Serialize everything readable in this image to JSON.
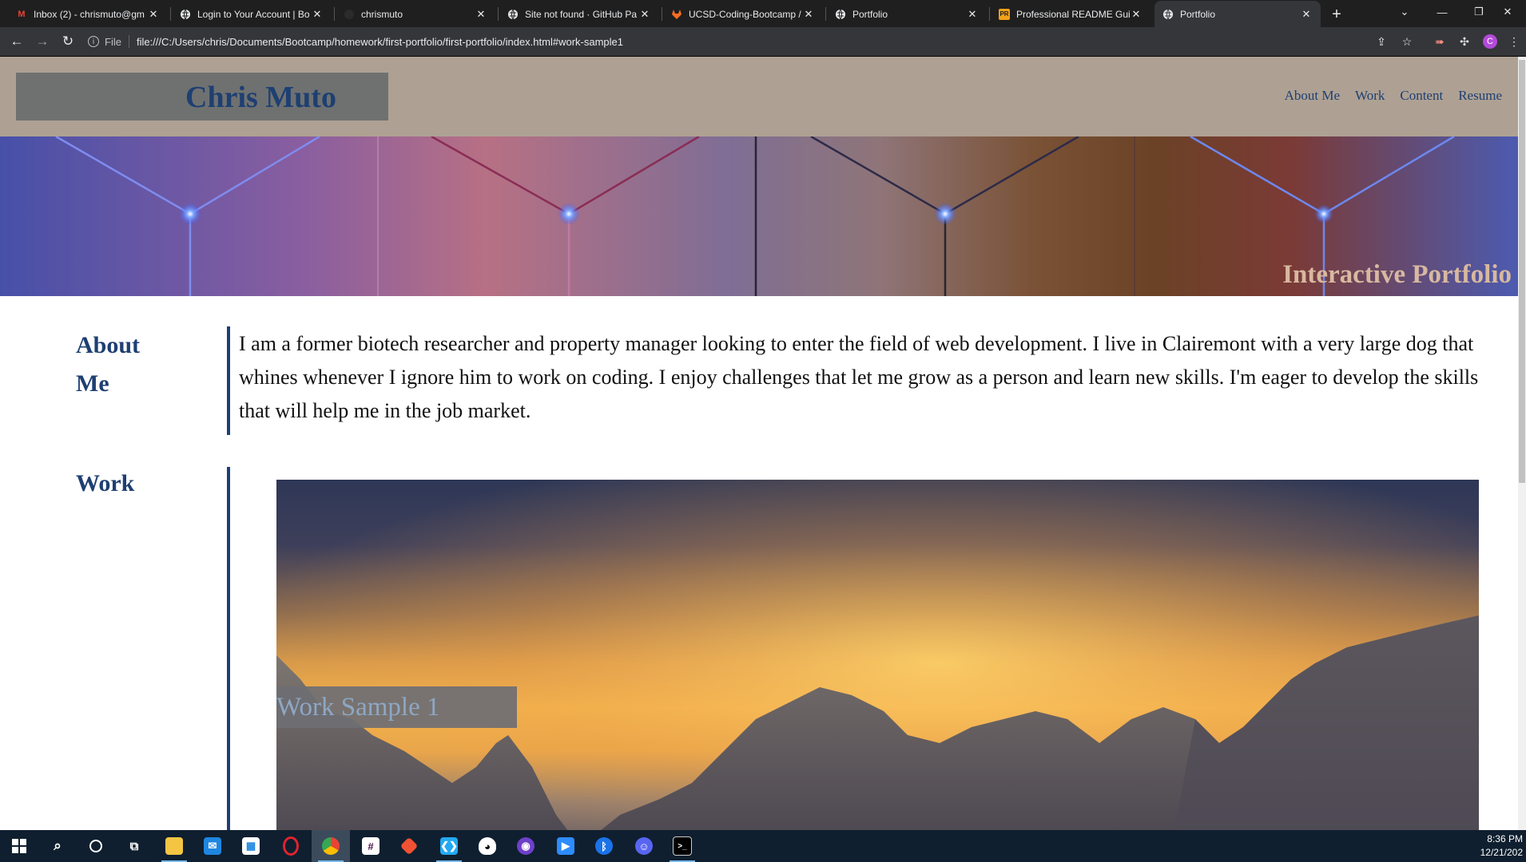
{
  "browser": {
    "tabs": [
      {
        "title": "Inbox (2) - chrismuto@gm",
        "icon": "gmail-icon"
      },
      {
        "title": "Login to Your Account | Bo",
        "icon": "globe-icon"
      },
      {
        "title": "chrismuto",
        "icon": "github-icon"
      },
      {
        "title": "Site not found · GitHub Pa",
        "icon": "globe-icon"
      },
      {
        "title": "UCSD-Coding-Bootcamp /",
        "icon": "gitlab-icon"
      },
      {
        "title": "Portfolio",
        "icon": "globe-icon"
      },
      {
        "title": "Professional README Guid",
        "icon": "readme-icon"
      },
      {
        "title": "Portfolio",
        "icon": "globe-icon"
      }
    ],
    "active_tab": 7,
    "address": {
      "scheme_label": "File",
      "url": "file:///C:/Users/chris/Documents/Bootcamp/homework/first-portfolio/first-portfolio/index.html#work-sample1"
    },
    "profile_initial": "C"
  },
  "page": {
    "header": {
      "name": "Chris Muto",
      "nav": [
        "About Me",
        "Work",
        "Content",
        "Resume"
      ]
    },
    "hero": {
      "title": "Interactive Portfolio"
    },
    "about": {
      "heading_line1": "About",
      "heading_line2": "Me",
      "text": "I am a former biotech researcher and property manager looking to enter the field of web development. I live in Clairemont with a very large dog that whines whenever I ignore him to work on coding. I enjoy challenges that let me grow as a person and learn new skills. I'm eager to develop the skills that will help me in the job market."
    },
    "work": {
      "heading": "Work",
      "sample_caption": "Work Sample 1"
    }
  },
  "taskbar": {
    "apps": [
      "start",
      "search",
      "cortana",
      "task-view",
      "file-explorer",
      "mail",
      "store",
      "opera",
      "chrome",
      "slack",
      "git",
      "vscode",
      "wsl-linux",
      "github-desktop",
      "zoom",
      "bluetooth",
      "discord",
      "terminal"
    ],
    "clock": {
      "time": "8:36 PM",
      "date": "12/21/202"
    }
  },
  "colors": {
    "header_bg": "#aea193",
    "accent_navy": "#1e3f72",
    "name_box": "#6f7170",
    "hero_title": "#d8b8a0"
  }
}
